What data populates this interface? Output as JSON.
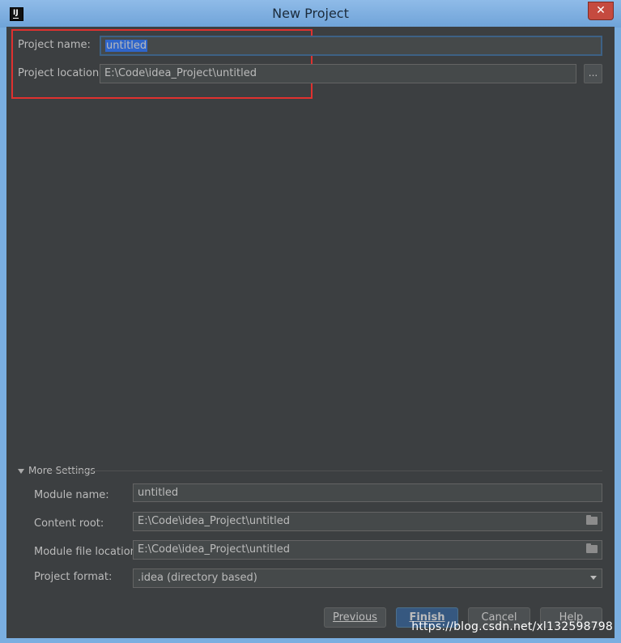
{
  "window": {
    "title": "New Project",
    "app_icon_text": "IJ",
    "close_glyph": "✕"
  },
  "project": {
    "name_label": "Project name:",
    "name_value": "untitled",
    "location_label": "Project location:",
    "location_value": "E:\\Code\\idea_Project\\untitled",
    "browse_label": "..."
  },
  "more_settings": {
    "label": "More Settings",
    "module_name_label": "Module name:",
    "module_name_value": "untitled",
    "content_root_label": "Content root:",
    "content_root_value": "E:\\Code\\idea_Project\\untitled",
    "module_file_location_label": "Module file location:",
    "module_file_location_value": "E:\\Code\\idea_Project\\untitled",
    "project_format_label": "Project format:",
    "project_format_value": ".idea (directory based)"
  },
  "buttons": {
    "previous": "Previous",
    "finish": "Finish",
    "cancel": "Cancel",
    "help": "Help"
  },
  "watermark": "https://blog.csdn.net/xl132598798",
  "colors": {
    "background": "#3c3f41",
    "highlight_box": "#e0312f",
    "selection": "#2f65ca",
    "title_bar": "#7aaee0"
  },
  "icons": {
    "app": "intellij-icon",
    "close": "close-icon",
    "folder": "folder-icon",
    "expand": "triangle-down-icon",
    "dropdown": "chevron-down-icon"
  }
}
